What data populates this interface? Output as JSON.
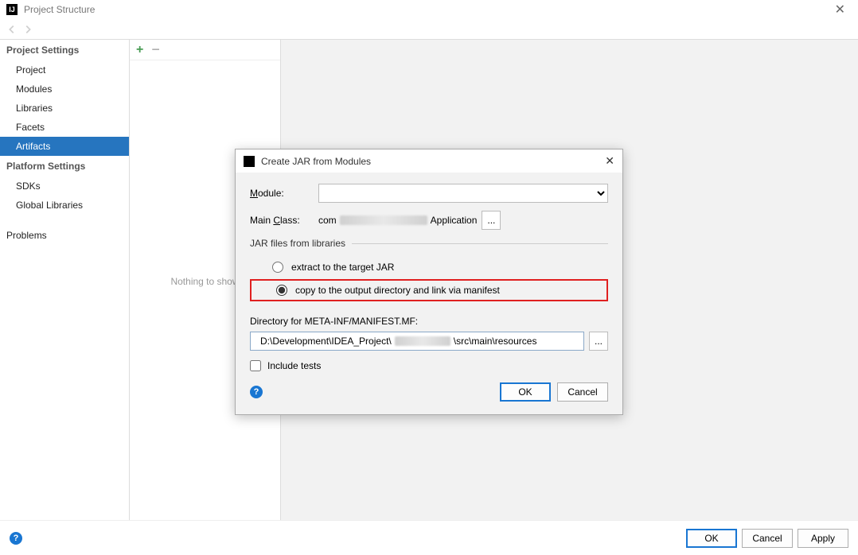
{
  "titlebar": {
    "title": "Project Structure"
  },
  "sidebar": {
    "sections": [
      {
        "header": "Project Settings",
        "items": [
          "Project",
          "Modules",
          "Libraries",
          "Facets",
          "Artifacts"
        ]
      },
      {
        "header": "Platform Settings",
        "items": [
          "SDKs",
          "Global Libraries"
        ]
      },
      {
        "header": "",
        "items": [
          "Problems"
        ]
      }
    ],
    "selected": "Artifacts"
  },
  "middle": {
    "empty_text": "Nothing to show"
  },
  "modal": {
    "title": "Create JAR from Modules",
    "module_label": "Module:",
    "module_value": "",
    "main_class_label": "Main Class:",
    "main_class_prefix": "com",
    "main_class_suffix": "Application",
    "fieldset": "JAR files from libraries",
    "radio1": "extract to the target JAR",
    "radio2": "copy to the output directory and link via manifest",
    "dir_label": "Directory for META-INF/MANIFEST.MF:",
    "dir_prefix": "D:\\Development\\IDEA_Project\\",
    "dir_suffix": "\\src\\main\\resources",
    "include_tests": "Include tests",
    "ok": "OK",
    "cancel": "Cancel"
  },
  "bottombar": {
    "ok": "OK",
    "cancel": "Cancel",
    "apply": "Apply"
  }
}
